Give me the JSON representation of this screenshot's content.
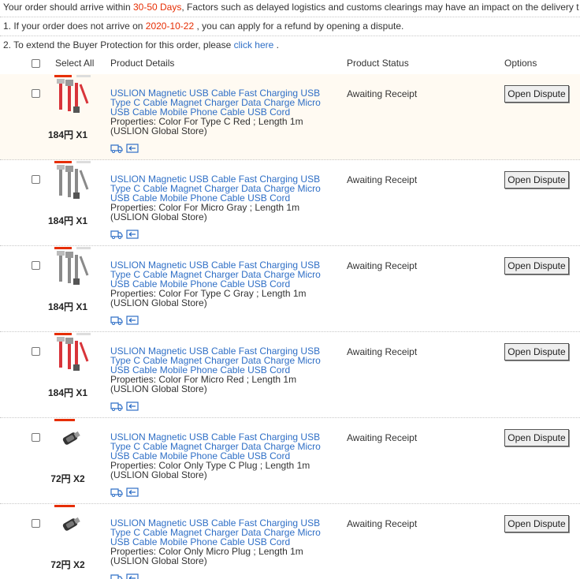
{
  "notices": {
    "arrive_prefix": "Your order should arrive within ",
    "arrive_days": "30-50 Days",
    "arrive_suffix": ", Factors such as delayed logistics and customs clearings may have an impact on the delivery t",
    "line1_prefix": "1. If your order does not arrive on ",
    "line1_date": "2020-10-22",
    "line1_suffix": " , you can apply for a refund by opening a dispute.",
    "line2_prefix": "2. To extend the Buyer Protection for this order, please ",
    "line2_link": "click here",
    "line2_suffix": " ."
  },
  "table_header": {
    "select_all": "Select All",
    "product_details": "Product Details",
    "product_status": "Product Status",
    "options": "Options"
  },
  "colors": {
    "accent_red": "#e62e04",
    "link_blue": "#2f6fc6",
    "row_highlight": "#fffaf2"
  },
  "items": [
    {
      "title": "USLION Magnetic USB Cable Fast Charging USB Type C Cable Magnet Charger Data Charge Micro USB Cable Mobile Phone Cable USB Cord",
      "properties": "Properties: Color For Type C Red   ; Length 1m",
      "store": "(USLION Global Store)",
      "price": "184円 X1",
      "status": "Awaiting Receipt",
      "option": "Open Dispute",
      "thumb": "red-cable"
    },
    {
      "title": "USLION Magnetic USB Cable Fast Charging USB Type C Cable Magnet Charger Data Charge Micro USB Cable Mobile Phone Cable USB Cord",
      "properties": "Properties: Color For Micro Gray   ; Length 1m",
      "store": "(USLION Global Store)",
      "price": "184円 X1",
      "status": "Awaiting Receipt",
      "option": "Open Dispute",
      "thumb": "gray-cable"
    },
    {
      "title": "USLION Magnetic USB Cable Fast Charging USB Type C Cable Magnet Charger Data Charge Micro USB Cable Mobile Phone Cable USB Cord",
      "properties": "Properties: Color For Type C Gray   ; Length 1m",
      "store": "(USLION Global Store)",
      "price": "184円 X1",
      "status": "Awaiting Receipt",
      "option": "Open Dispute",
      "thumb": "gray-cable"
    },
    {
      "title": "USLION Magnetic USB Cable Fast Charging USB Type C Cable Magnet Charger Data Charge Micro USB Cable Mobile Phone Cable USB Cord",
      "properties": "Properties: Color For Micro Red   ; Length 1m",
      "store": "(USLION Global Store)",
      "price": "184円 X1",
      "status": "Awaiting Receipt",
      "option": "Open Dispute",
      "thumb": "red-cable"
    },
    {
      "title": "USLION Magnetic USB Cable Fast Charging USB Type C Cable Magnet Charger Data Charge Micro USB Cable Mobile Phone Cable USB Cord",
      "properties": "Properties: Color Only Type C Plug   ; Length 1m",
      "store": "(USLION Global Store)",
      "price": "72円 X2",
      "status": "Awaiting Receipt",
      "option": "Open Dispute",
      "thumb": "plug"
    },
    {
      "title": "USLION Magnetic USB Cable Fast Charging USB Type C Cable Magnet Charger Data Charge Micro USB Cable Mobile Phone Cable USB Cord",
      "properties": "Properties: Color Only Micro Plug   ; Length 1m",
      "store": "(USLION Global Store)",
      "price": "72円 X2",
      "status": "Awaiting Receipt",
      "option": "Open Dispute",
      "thumb": "plug"
    }
  ]
}
